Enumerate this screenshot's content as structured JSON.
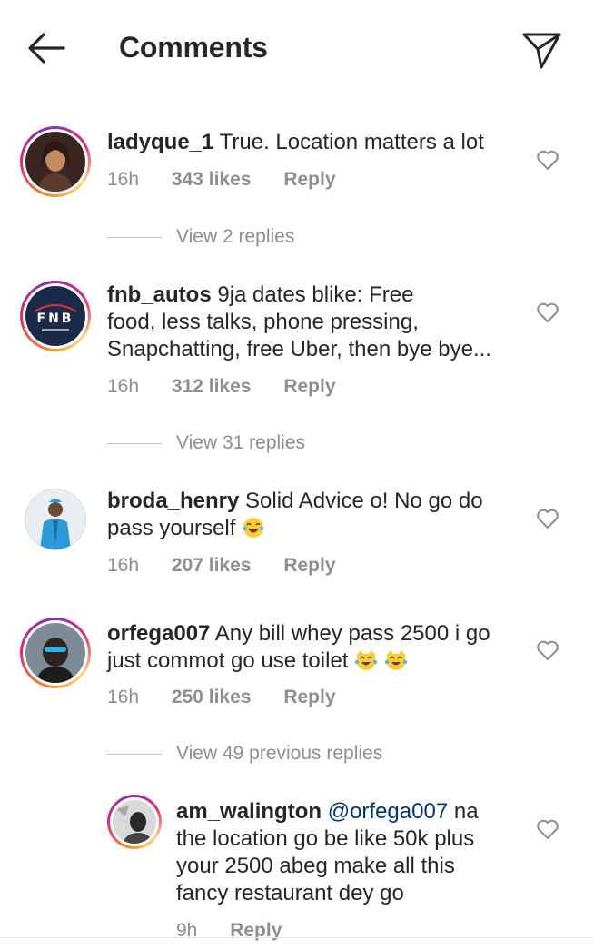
{
  "header": {
    "title": "Comments"
  },
  "comments": [
    {
      "username": "ladyque_1",
      "text": "True. Location matters a lot",
      "time": "16h",
      "likes": "343 likes",
      "reply": "Reply",
      "view_replies": "View 2 replies"
    },
    {
      "username": "fnb_autos",
      "text_line1": "9ja dates blike: Free",
      "text_line2": "food, less talks, phone pressing,",
      "text_line3": "Snapchatting, free Uber, then bye bye...",
      "time": "16h",
      "likes": "312 likes",
      "reply": "Reply",
      "view_replies": "View 31 replies",
      "avatar_text": "FNB"
    },
    {
      "username": "broda_henry",
      "text_line1": "Solid Advice o! No go do",
      "text_line2": "pass yourself",
      "time": "16h",
      "likes": "207 likes",
      "reply": "Reply"
    },
    {
      "username": "orfega007",
      "text_line1": "Any bill whey pass 2500 i go",
      "text_line2": "just commot go use toilet",
      "time": "16h",
      "likes": "250 likes",
      "reply": "Reply",
      "view_replies": "View 49 previous replies"
    }
  ],
  "reply": {
    "username": "am_walington",
    "mention": "@orfega007",
    "text_line1_rest": "na",
    "text_line2": "the location go be like 50k plus",
    "text_line3": "your 2500 abeg make all this",
    "text_line4": "fancy restaurant dey go",
    "time": "9h",
    "reply": "Reply"
  },
  "colors": {
    "text": "#262626",
    "secondary": "#8e8e8e",
    "mention": "#00376b"
  }
}
